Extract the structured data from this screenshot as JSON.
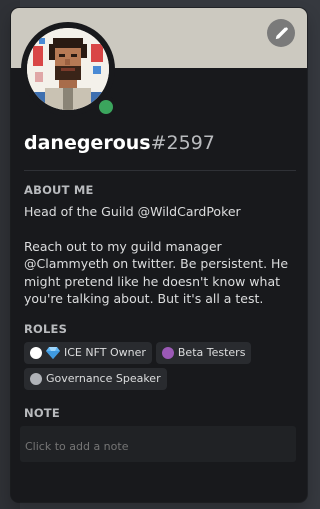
{
  "colors": {
    "banner": "#ccc9c0",
    "card": "#18191c",
    "status_online": "#3ba55d",
    "role_ice": "#ffffff",
    "role_beta": "#9b59b6",
    "role_governance": "#b0b3b8"
  },
  "profile": {
    "username": "danegerous",
    "discriminator": "#2597",
    "status": "online",
    "avatar": "pixel-art-portrait",
    "edit_icon": "pencil-icon"
  },
  "about": {
    "heading": "ABOUT ME",
    "line1": "Head of the Guild @WildCardPoker",
    "line2": "Reach out to my guild manager @Clammyeth on twitter. Be persistent. He might pretend like he doesn't know what you're talking about. But it's all a test."
  },
  "roles": {
    "heading": "ROLES",
    "items": [
      {
        "label": "ICE NFT Owner",
        "icon": "diamond-icon"
      },
      {
        "label": "Beta Testers"
      },
      {
        "label": "Governance Speaker"
      }
    ]
  },
  "note": {
    "heading": "NOTE",
    "placeholder": "Click to add a note"
  }
}
